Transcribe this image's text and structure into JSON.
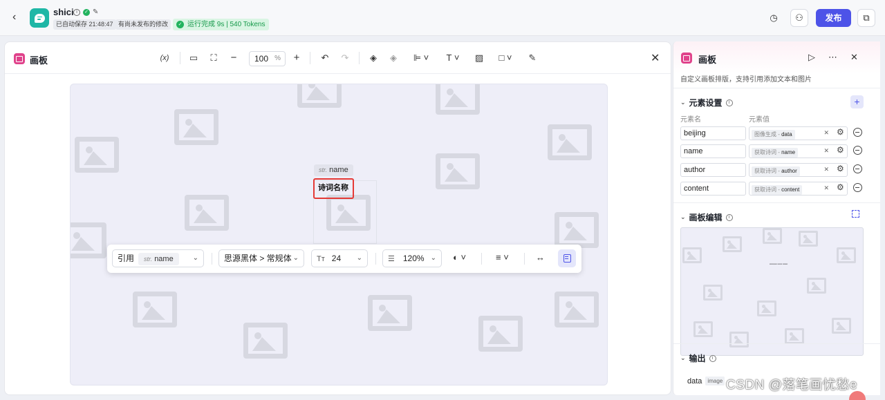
{
  "header": {
    "app_name": "shici",
    "autosave": "已自动保存 21:48:47",
    "unpublished": "有尚未发布的修改",
    "run_status": "运行完成 9s | 540 Tokens",
    "publish_label": "发布",
    "accent_color": "#4d53e8",
    "success_color": "#22b35e"
  },
  "canvas_panel": {
    "title": "画板",
    "variable_tool": "(x)",
    "zoom_value": "100",
    "zoom_unit": "%",
    "element_tag_type": "str.",
    "element_tag_name": "name",
    "element_text": "诗词名称"
  },
  "text_toolbar": {
    "ref_label": "引用",
    "ref_tag_type": "str.",
    "ref_tag_name": "name",
    "font": "思源黑体 > 常规体",
    "font_size": "24",
    "line_height": "120%"
  },
  "right_panel": {
    "title": "画板",
    "description": "自定义画板排版，支持引用添加文本和图片",
    "element_settings_title": "元素设置",
    "col_name": "元素名",
    "col_value": "元素值",
    "elements": [
      {
        "name": "beijing",
        "source": "图像生成 - ",
        "value": "data"
      },
      {
        "name": "name",
        "source": "获取诗词 - ",
        "value": "name"
      },
      {
        "name": "author",
        "source": "获取诗词 - ",
        "value": "author"
      },
      {
        "name": "content",
        "source": "获取诗词 - ",
        "value": "content"
      }
    ],
    "canvas_edit_title": "画板编辑",
    "output_title": "输出",
    "output_var": "data",
    "output_type": "image"
  },
  "watermark": "CSDN @落笔画忧愁e"
}
